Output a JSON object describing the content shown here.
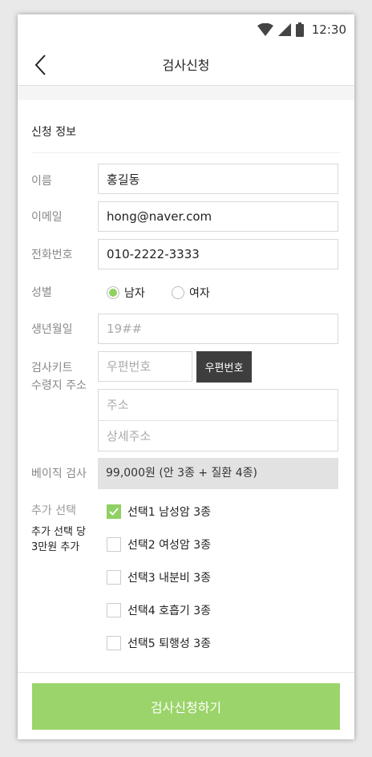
{
  "status_bar": {
    "time": "12:30"
  },
  "header": {
    "title": "검사신청"
  },
  "section": {
    "title": "신청 정보"
  },
  "form": {
    "name": {
      "label": "이름",
      "value": "홍길동"
    },
    "email": {
      "label": "이메일",
      "value": "hong@naver.com"
    },
    "phone": {
      "label": "전화번호",
      "value": "010-2222-3333"
    },
    "gender": {
      "label": "성별",
      "options": [
        {
          "label": "남자",
          "selected": true
        },
        {
          "label": "여자",
          "selected": false
        }
      ]
    },
    "birth": {
      "label": "생년월일",
      "placeholder": "19##"
    },
    "address": {
      "label_line1": "검사키트",
      "label_line2": "수령지 주소",
      "zip_placeholder": "우편번호",
      "zip_button": "우편번호",
      "address_placeholder": "주소",
      "detail_placeholder": "상세주소"
    },
    "basic": {
      "label": "베이직 검사",
      "value": "99,000원 (안 3종 + 질환 4종)"
    },
    "extra": {
      "label": "추가 선택",
      "note_line1": "추가 선택 당",
      "note_line2": "3만원 추가",
      "options": [
        {
          "label": "선택1 남성암 3종",
          "checked": true
        },
        {
          "label": "선택2 여성암 3종",
          "checked": false
        },
        {
          "label": "선택3 내분비 3종",
          "checked": false
        },
        {
          "label": "선택4 호흡기 3종",
          "checked": false
        },
        {
          "label": "선택5 퇴행성 3종",
          "checked": false
        }
      ]
    }
  },
  "submit": {
    "label": "검사신청하기"
  },
  "colors": {
    "accent": "#9bd46a",
    "dark_button": "#3e3e3e",
    "basic_bg": "#e2e2e2"
  }
}
